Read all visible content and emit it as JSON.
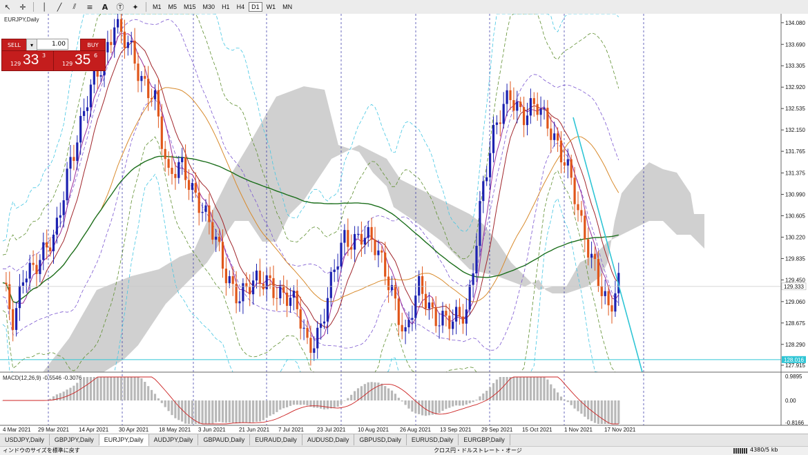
{
  "toolbar": {
    "icons": [
      "cursor-icon",
      "crosshair-icon",
      "vertical-line-icon",
      "trendline-icon",
      "equidistant-channel-icon",
      "fibonacci-icon",
      "text-icon",
      "text-label-icon",
      "shapes-icon"
    ],
    "timeframes": [
      "M1",
      "M5",
      "M15",
      "M30",
      "H1",
      "H4",
      "D1",
      "W1",
      "MN"
    ],
    "active_timeframe": "D1"
  },
  "chart": {
    "symbol_label": "EURJPY,Daily",
    "current_price": "129.333",
    "support_price": "128.016",
    "price_ticks": [
      "134.080",
      "133.690",
      "133.305",
      "132.920",
      "132.535",
      "132.150",
      "131.765",
      "131.375",
      "130.990",
      "130.605",
      "130.220",
      "129.835",
      "129.450",
      "129.060",
      "128.675",
      "128.290",
      "127.915"
    ],
    "date_labels": [
      "4 Mar 2021",
      "29 Mar 2021",
      "14 Apr 2021",
      "30 Apr 2021",
      "18 May 2021",
      "3 Jun 2021",
      "21 Jun 2021",
      "7 Jul 2021",
      "23 Jul 2021",
      "10 Aug 2021",
      "26 Aug 2021",
      "13 Sep 2021",
      "29 Sep 2021",
      "15 Oct 2021",
      "1 Nov 2021",
      "17 Nov 2021"
    ],
    "colors": {
      "bull": "#1c22b0",
      "bear": "#e0561a",
      "cloud": "#c8c8c8",
      "ma_green": "#1b6e1b",
      "ma_orange": "#d88a2c",
      "ma_red": "#a0242a",
      "ma_purple": "#9a2c9a",
      "bb_cyan": "#43c6e3",
      "bb_violet": "#7a55d0",
      "bb_olive": "#5d8e2e",
      "trend": "#2fc5d5"
    }
  },
  "trade_panel": {
    "sell_label": "SELL",
    "buy_label": "BUY",
    "lot": "1.00",
    "sell_small": "129",
    "sell_big": "33",
    "sell_sup": "3",
    "buy_small": "129",
    "buy_big": "35",
    "buy_sup": "6"
  },
  "macd": {
    "label": "MACD(12,26,9) -0.5546 -0.3076",
    "ticks": [
      "0.9895",
      "0.00",
      "-0.8166"
    ]
  },
  "tabs": [
    "USDJPY,Daily",
    "GBPJPY,Daily",
    "EURJPY,Daily",
    "AUDJPY,Daily",
    "GBPAUD,Daily",
    "EURAUD,Daily",
    "AUDUSD,Daily",
    "GBPUSD,Daily",
    "EURUSD,Daily",
    "EURGBP,Daily"
  ],
  "active_tab": "EURJPY,Daily",
  "status": {
    "left": "ィンドウのサイズを標準に戻す",
    "mid": "クロス円・ドルストレート・オージ",
    "right": "4380/5 kb"
  }
}
